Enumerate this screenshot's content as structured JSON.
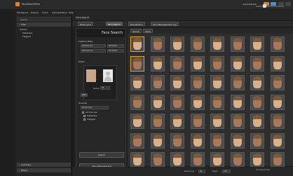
{
  "window": {
    "title": "FaceSearchMine",
    "account": "Administrator"
  },
  "menu": [
    "Workspace",
    "Module",
    "Users",
    "Administration",
    "Help"
  ],
  "left_panel": {
    "search_placeholder": "Search",
    "headers": [
      "Tiles"
    ],
    "tree": [
      "Gallery",
      "Database",
      "Flagged"
    ],
    "bottom_headers": [
      "Summary",
      "Filters"
    ]
  },
  "tabs": {
    "items": [
      "Face Search",
      "Photo Grid",
      "Face Search",
      "Recognition",
      "Face Management Log"
    ]
  },
  "toolbar": {
    "buttons": [
      "Search",
      "Clear"
    ]
  },
  "face_search": {
    "title": "Face Search",
    "date_label": "Capture Date",
    "from_value": "2023-01-12",
    "to_value": "2023-03-12",
    "time_from": "00:00:00",
    "time_to": "23:59:59",
    "photo_label": "Photo",
    "threshold_label": "Score",
    "threshold_value": "75",
    "add_button": "Add",
    "sources_label": "Sources",
    "select_value": "All Sources",
    "sources": [
      "All Sources",
      "Database",
      "Flagged"
    ],
    "search_button": "Search",
    "manage_button": "Face Management"
  },
  "status": {
    "page_label": "Results per",
    "page_value": "20",
    "of_label": "Pages",
    "count": "120",
    "zoom_label": "Thumbnail Size"
  },
  "colors": {
    "accent": "#e67e22",
    "face_light": "#d8b08c",
    "face_dark": "#a8785a",
    "selected": "#e8a030"
  }
}
